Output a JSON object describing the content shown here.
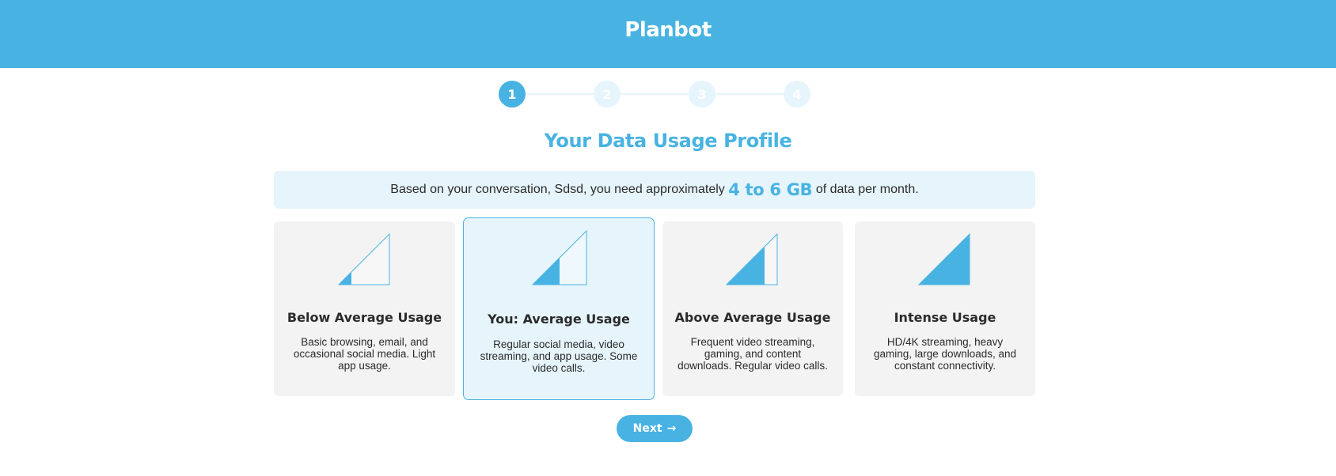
{
  "header": {
    "brand": "Planbot"
  },
  "stepper": {
    "steps": [
      {
        "label": "1",
        "active": true
      },
      {
        "label": "2",
        "active": false
      },
      {
        "label": "3",
        "active": false
      },
      {
        "label": "4",
        "active": false
      }
    ]
  },
  "page": {
    "title": "Your Data Usage Profile"
  },
  "banner": {
    "prefix": "Based on your conversation, Sdsd, you need approximately ",
    "highlight": "4 to 6 GB",
    "suffix": " of data per month."
  },
  "cards": [
    {
      "title": "Below Average Usage",
      "description": "Basic browsing, email, and occasional social media. Light app usage.",
      "icon": "signal-low-icon",
      "level": 0.25,
      "selected": false
    },
    {
      "title": "You: Average Usage",
      "description": "Regular social media, video streaming, and app usage. Some video calls.",
      "icon": "signal-medium-icon",
      "level": 0.5,
      "selected": true
    },
    {
      "title": "Above Average Usage",
      "description": "Frequent video streaming, gaming, and content downloads. Regular video calls.",
      "icon": "signal-high-icon",
      "level": 0.75,
      "selected": false
    },
    {
      "title": "Intense Usage",
      "description": "HD/4K streaming, heavy gaming, large downloads, and constant connectivity.",
      "icon": "signal-full-icon",
      "level": 1.0,
      "selected": false
    }
  ],
  "actions": {
    "next_label": "Next",
    "next_icon": "→"
  },
  "colors": {
    "accent": "#48b3e2",
    "accent_light": "#e6f4fb",
    "card_bg": "#f3f3f3"
  }
}
